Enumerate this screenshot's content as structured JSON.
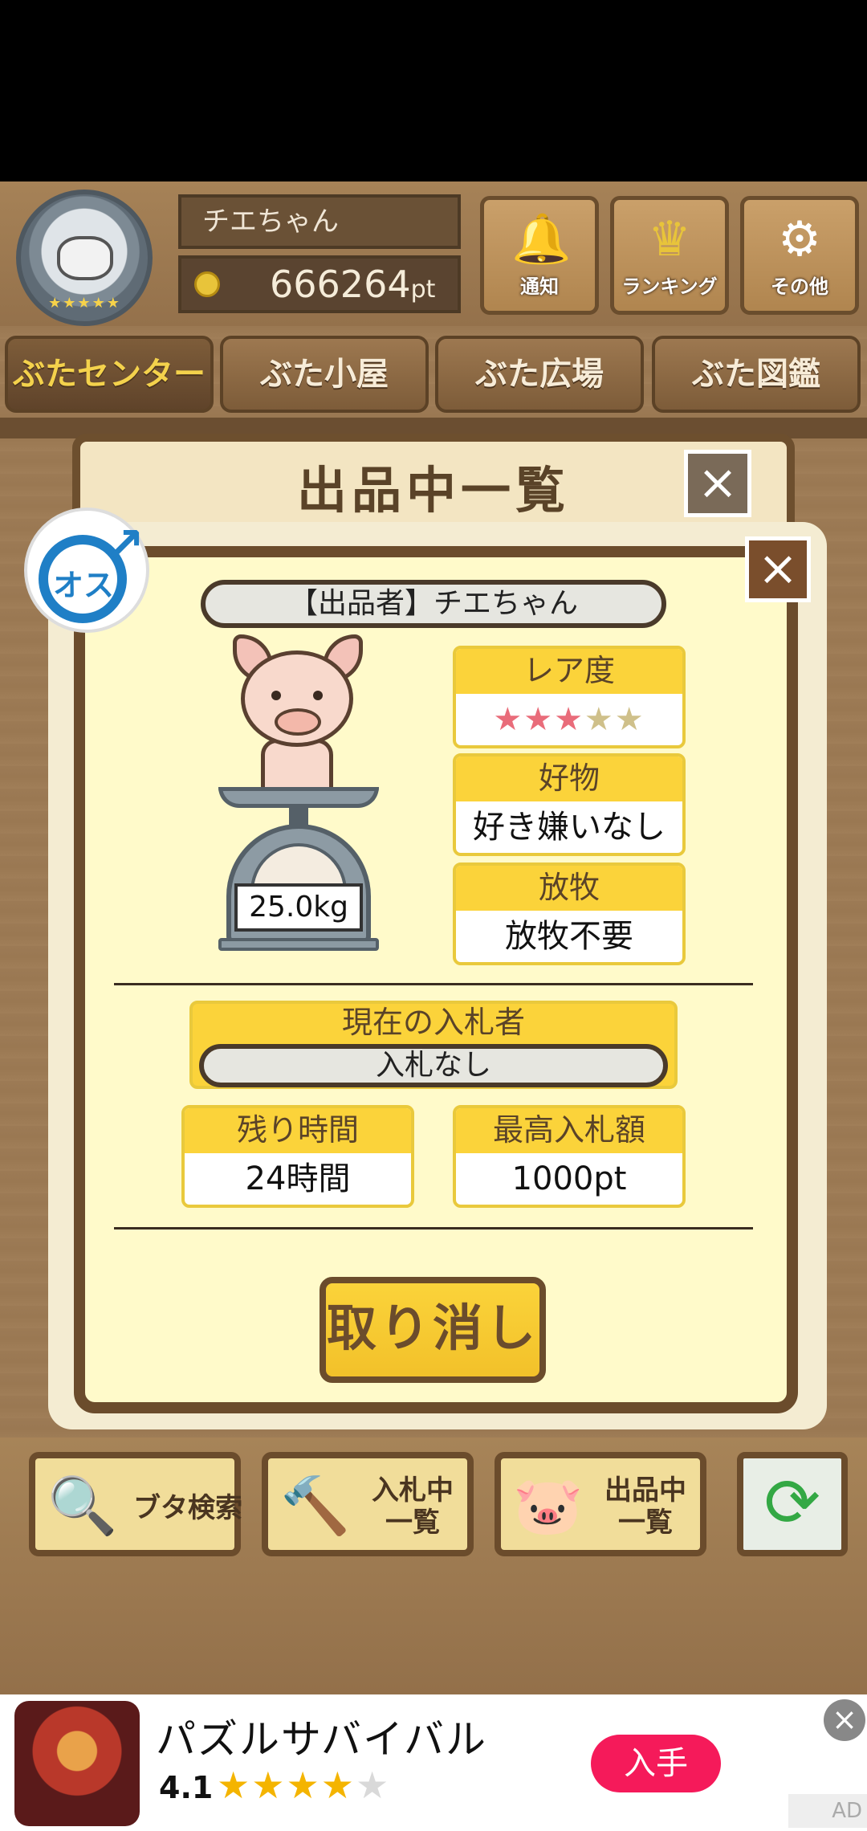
{
  "header": {
    "player_name": "チエちゃん",
    "points": "666264",
    "points_unit": "pt",
    "buttons": [
      {
        "label": "通知",
        "icon": "bell-icon"
      },
      {
        "label": "ランキング",
        "icon": "crown-icon"
      },
      {
        "label": "その他",
        "icon": "gear-icon"
      }
    ]
  },
  "tabs": [
    {
      "label": "ぶたセンター",
      "active": true
    },
    {
      "label": "ぶた小屋",
      "active": false
    },
    {
      "label": "ぶた広場",
      "active": false
    },
    {
      "label": "ぶた図鑑",
      "active": false
    }
  ],
  "panel": {
    "title": "出品中一覧"
  },
  "dialog": {
    "gender_label": "オス",
    "seller": "【出品者】チエちゃん",
    "weight": "25.0kg",
    "rarity": {
      "label": "レア度",
      "stars_filled": 3,
      "stars_total": 5
    },
    "favorite": {
      "label": "好物",
      "value": "好き嫌いなし"
    },
    "grazing": {
      "label": "放牧",
      "value": "放牧不要"
    },
    "current_bidder": {
      "label": "現在の入札者",
      "value": "入札なし"
    },
    "time_left": {
      "label": "残り時間",
      "value": "24時間"
    },
    "top_bid": {
      "label": "最高入札額",
      "value": "1000pt"
    },
    "cancel_label": "取り消し"
  },
  "toolbar": {
    "search": "ブタ検索",
    "bidding_line1": "入札中",
    "bidding_line2": "一覧",
    "listing_line1": "出品中",
    "listing_line2": "一覧"
  },
  "ad": {
    "title": "パズルサバイバル",
    "rating": "4.1",
    "stars_filled": 4,
    "stars_total": 5,
    "cta": "入手",
    "badge": "AD"
  },
  "colors": {
    "accent_yellow": "#fbd33a",
    "wood_dark": "#6b4c2c",
    "dialog_bg": "#fffaca",
    "star_on": "#e96c7a",
    "ad_cta": "#f51a5a"
  }
}
